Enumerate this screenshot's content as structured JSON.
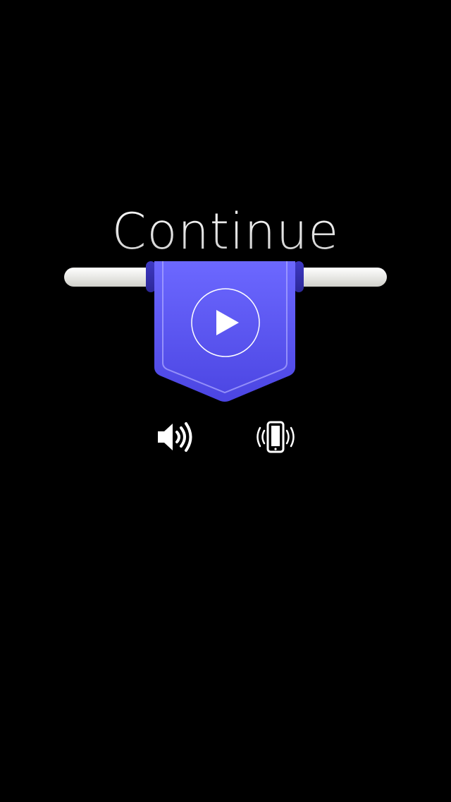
{
  "title": "Continue",
  "play_button": {
    "icon": "play-icon"
  },
  "sound_toggle": {
    "icon": "speaker-icon",
    "state": "on"
  },
  "vibration_toggle": {
    "icon": "phone-vibrate-icon",
    "state": "on"
  },
  "colors": {
    "background": "#000000",
    "banner_top": "#6a66ff",
    "banner_bottom": "#4a44e0",
    "rod": "#f0f0ec",
    "icon": "#ffffff"
  }
}
